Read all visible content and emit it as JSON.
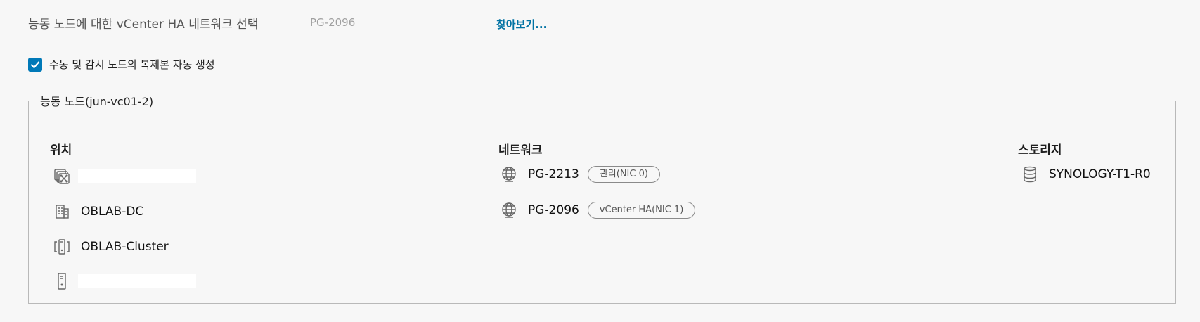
{
  "top": {
    "label": "능동 노드에 대한 vCenter HA 네트워크 선택",
    "network_value": "PG-2096",
    "browse_label": "찾아보기..."
  },
  "checkbox": {
    "label": "수동 및 감시 노드의 복제본 자동 생성",
    "checked": true
  },
  "node": {
    "legend": "능동 노드(jun-vc01-2)",
    "location": {
      "header": "위치",
      "items": [
        {
          "icon": "vcenter-icon",
          "label": ""
        },
        {
          "icon": "datacenter-icon",
          "label": "OBLAB-DC"
        },
        {
          "icon": "cluster-icon",
          "label": "OBLAB-Cluster"
        },
        {
          "icon": "host-icon",
          "label": ""
        }
      ]
    },
    "network": {
      "header": "네트워크",
      "items": [
        {
          "icon": "network-icon",
          "label": "PG-2213",
          "badge": "관리(NIC 0)"
        },
        {
          "icon": "network-icon",
          "label": "PG-2096",
          "badge": "vCenter HA(NIC 1)"
        }
      ]
    },
    "storage": {
      "header": "스토리지",
      "items": [
        {
          "icon": "datastore-icon",
          "label": "SYNOLOGY-T1-R0"
        }
      ]
    }
  },
  "colors": {
    "accent": "#0079b8",
    "link": "#0072a3"
  }
}
